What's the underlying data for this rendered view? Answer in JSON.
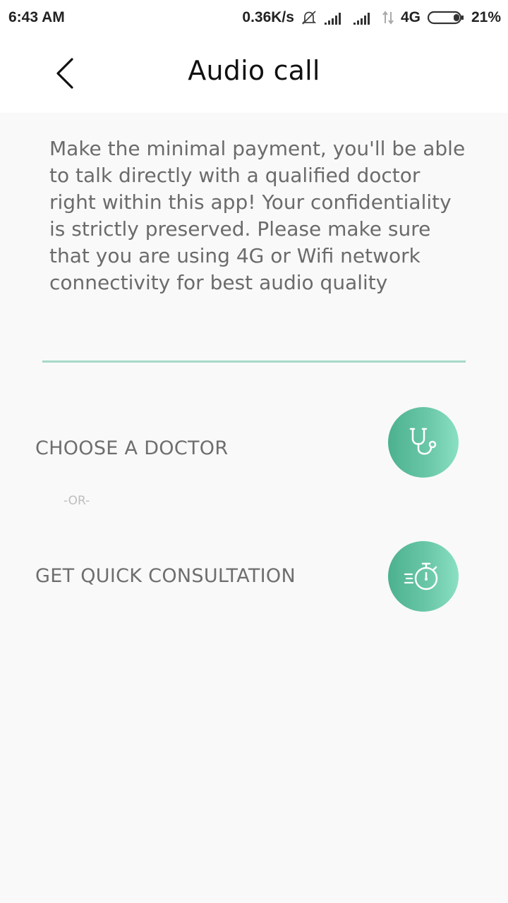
{
  "status_bar": {
    "time": "6:43 AM",
    "network_speed": "0.36K/s",
    "network_type": "4G",
    "battery": "21%",
    "icons": [
      "mute-bell-icon",
      "signal-icon",
      "signal-icon",
      "data-arrows-icon",
      "battery-icon"
    ]
  },
  "header": {
    "title": "Audio call",
    "back_icon": "chevron-left-icon"
  },
  "description": "Make the minimal payment, you'll be able to talk directly with a qualified doctor right within this app! Your confidentiality is strictly preserved. Please make sure that you are using 4G or Wifi network connectivity for best audio quality",
  "options": {
    "choose_doctor": {
      "label": "CHOOSE A DOCTOR",
      "icon": "stethoscope-icon"
    },
    "separator": "-OR-",
    "quick_consultation": {
      "label": "GET QUICK CONSULTATION",
      "icon": "stopwatch-icon"
    }
  },
  "colors": {
    "accent_divider": "#a6d8c8",
    "circle_start": "#4cb18f",
    "circle_end": "#8ae0c3",
    "text_gray": "#6b6b6b",
    "or_gray": "#bdbdbd"
  }
}
